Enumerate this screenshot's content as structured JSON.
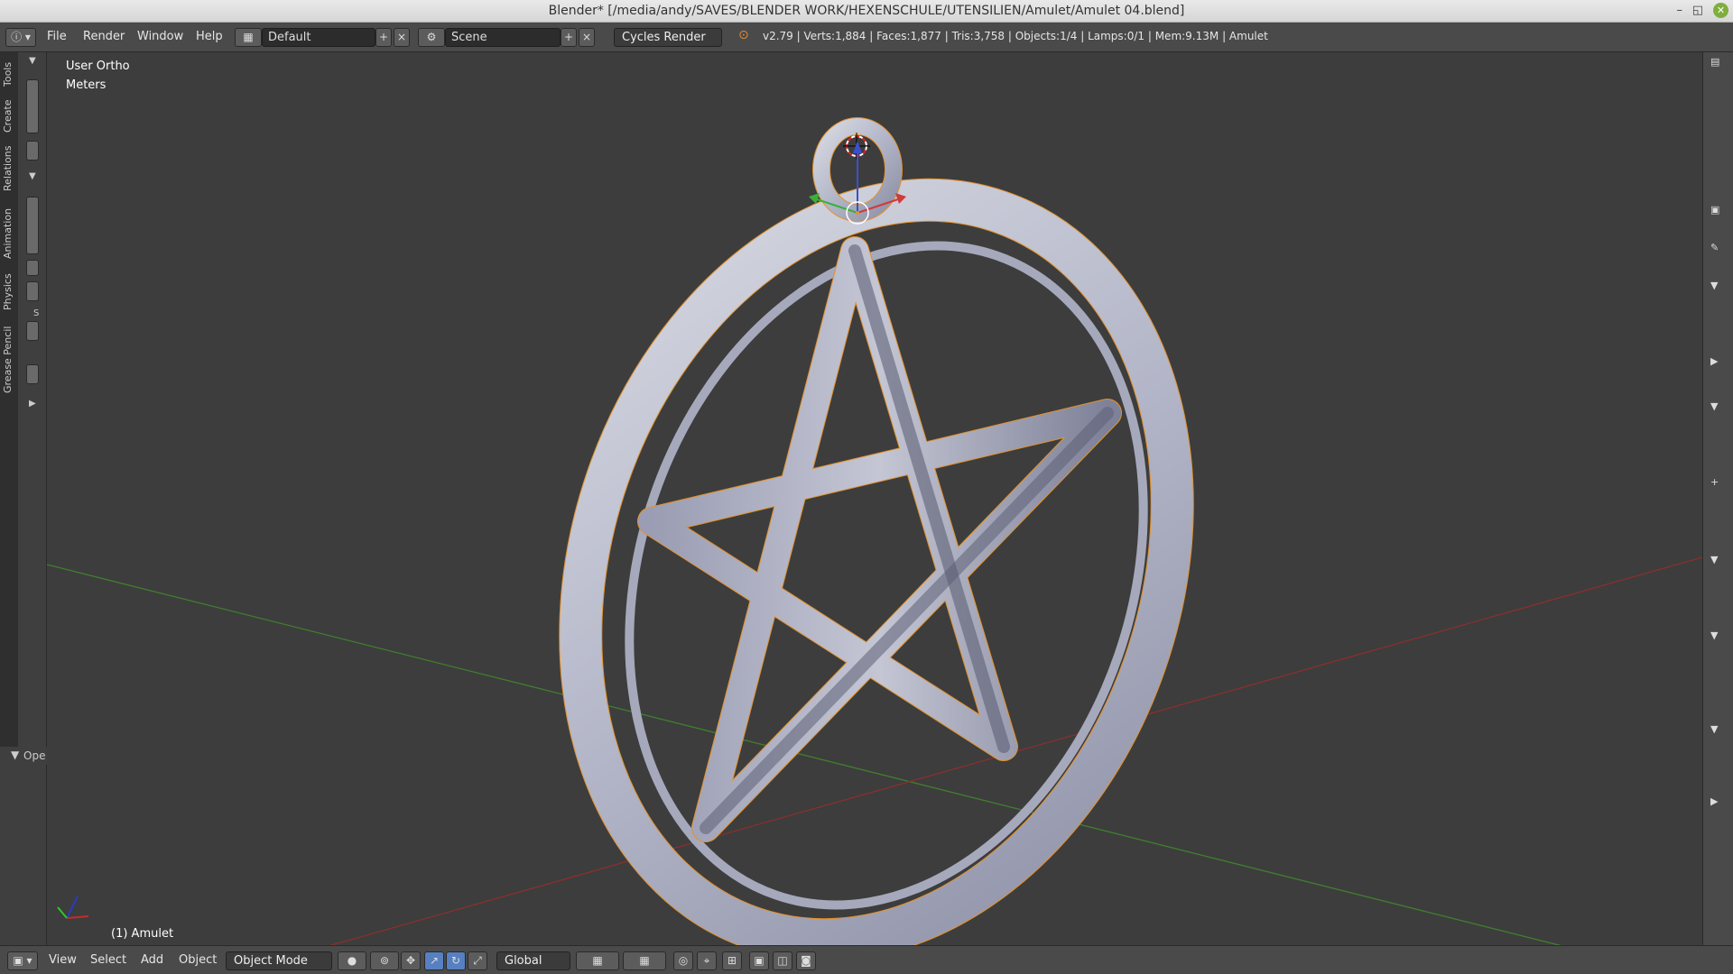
{
  "window": {
    "title": "Blender* [/media/andy/SAVES/BLENDER WORK/HEXENSCHULE/UTENSILIEN/Amulet/Amulet 04.blend]",
    "minimize_glyph": "–",
    "restore_glyph": "◱",
    "close_glyph": "✕"
  },
  "infobar": {
    "menus": [
      "File",
      "Render",
      "Window",
      "Help"
    ],
    "layout_name": "Default",
    "scene_name": "Scene",
    "render_engine": "Cycles Render",
    "stats": "v2.79 | Verts:1,884 | Faces:1,877 | Tris:3,758 | Objects:1/4 | Lamps:0/1 | Mem:9.13M | Amulet"
  },
  "toolshelf": {
    "tabs": [
      "Tools",
      "Create",
      "Relations",
      "Animation",
      "Physics",
      "Grease Pencil"
    ],
    "operator_panel": "Ope",
    "s_label": "S"
  },
  "viewport": {
    "view_name": "User Ortho",
    "units": "Meters",
    "active_object": "(1) Amulet",
    "colors": {
      "background": "#3d3d3d",
      "x_axis": "#8a2f2f",
      "y_axis": "#3f7f2f",
      "mesh": "#b9bccc",
      "selection_outline": "#e3912a"
    }
  },
  "bottombar": {
    "menus": [
      "View",
      "Select",
      "Add",
      "Object"
    ],
    "mode": "Object Mode",
    "orientation": "Global"
  },
  "icons": {
    "editor_type": "info-icon",
    "viewport_shading": "solid-sphere-icon",
    "pivot": "pivot-icon",
    "manipulator": "manipulator-icon"
  }
}
